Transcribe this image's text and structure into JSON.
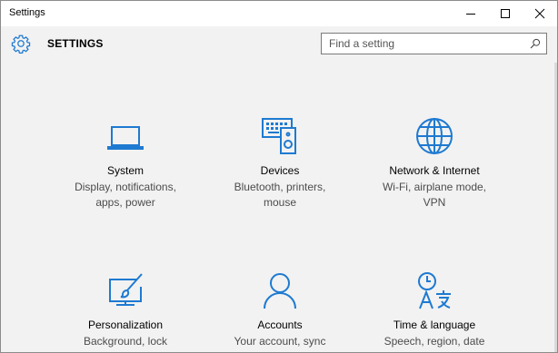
{
  "window": {
    "title": "Settings"
  },
  "header": {
    "title": "SETTINGS"
  },
  "search": {
    "placeholder": "Find a setting"
  },
  "accent": "#1e7ad1",
  "tiles": [
    {
      "name": "System",
      "desc": "Display, notifications,\napps, power",
      "icon": "laptop-icon"
    },
    {
      "name": "Devices",
      "desc": "Bluetooth, printers,\nmouse",
      "icon": "devices-icon"
    },
    {
      "name": "Network & Internet",
      "desc": "Wi-Fi, airplane mode,\nVPN",
      "icon": "globe-icon"
    },
    {
      "name": "Personalization",
      "desc": "Background, lock\nscreen, colors",
      "icon": "paint-icon"
    },
    {
      "name": "Accounts",
      "desc": "Your account, sync\nsettings, work, other",
      "icon": "person-icon"
    },
    {
      "name": "Time & language",
      "desc": "Speech, region, date",
      "icon": "time-language-icon"
    }
  ]
}
